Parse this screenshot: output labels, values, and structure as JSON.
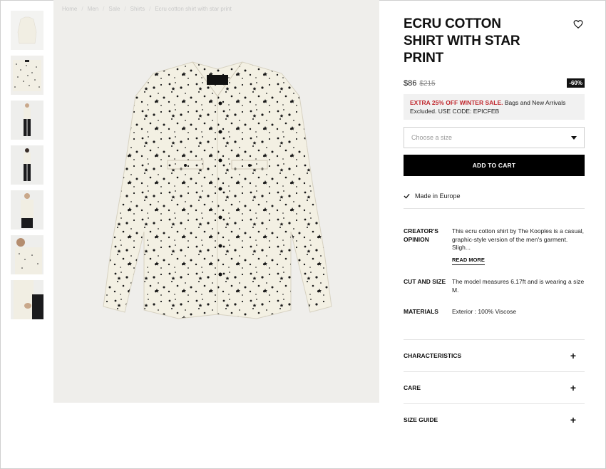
{
  "breadcrumb": [
    "Home",
    "Men",
    "Sale",
    "Shirts",
    "Ecru cotton shirt with star print"
  ],
  "product": {
    "title": "ECRU COTTON SHIRT WITH STAR PRINT",
    "price": "$86",
    "old_price": "$215",
    "discount": "-60%"
  },
  "promo": {
    "highlight": "EXTRA 25% OFF WINTER SALE.",
    "text": " Bags and New Arrivals Excluded. USE CODE: EPICFEB"
  },
  "size_select": {
    "placeholder": "Choose a size"
  },
  "add_to_cart": "ADD TO CART",
  "made_in": "Made in Europe",
  "specs": [
    {
      "label": "CREATOR'S OPINION",
      "value": "This ecru cotton shirt by The Kooples is a casual, graphic-style version of the men's garment. Sligh...",
      "link": "READ MORE"
    },
    {
      "label": "CUT AND SIZE",
      "value": "The model measures 6.17ft and is wearing a size M."
    },
    {
      "label": "MATERIALS",
      "value": "Exterior : 100% Viscose"
    }
  ],
  "accordions": [
    "CHARACTERISTICS",
    "CARE",
    "SIZE GUIDE"
  ],
  "thumbnails": [
    "shirt-front",
    "shirt-folded",
    "model-front",
    "model-back",
    "model-crop",
    "model-close",
    "model-detail"
  ],
  "shirt_label": "THE KOOPLES",
  "colors": {
    "accent_red": "#c0272d",
    "button_black": "#000000",
    "image_bg": "#efeeeb",
    "shirt": "#f3f0e3"
  }
}
